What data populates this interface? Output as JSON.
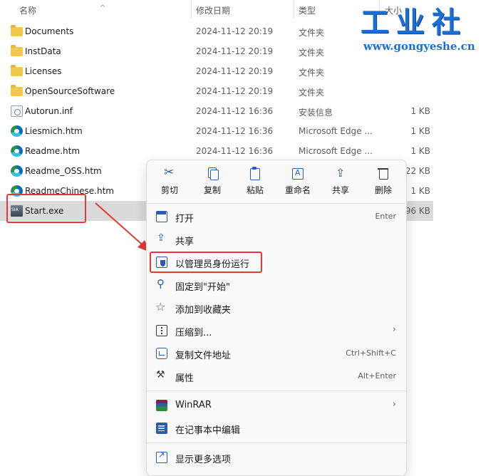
{
  "columns": {
    "name": "名称",
    "date": "修改日期",
    "type": "类型",
    "size": "大小"
  },
  "files": [
    {
      "name": "Documents",
      "date": "2024-11-12 20:19",
      "type": "文件夹",
      "size": "",
      "icon": "folder-icon"
    },
    {
      "name": "InstData",
      "date": "2024-11-12 20:19",
      "type": "文件夹",
      "size": "",
      "icon": "folder-icon"
    },
    {
      "name": "Licenses",
      "date": "2024-11-12 20:19",
      "type": "文件夹",
      "size": "",
      "icon": "folder-icon"
    },
    {
      "name": "OpenSourceSoftware",
      "date": "2024-11-12 20:19",
      "type": "文件夹",
      "size": "",
      "icon": "folder-icon"
    },
    {
      "name": "Autorun.inf",
      "date": "2024-11-12 16:36",
      "type": "安装信息",
      "size": "1 KB",
      "icon": "setup-info-icon"
    },
    {
      "name": "Liesmich.htm",
      "date": "2024-11-12 16:36",
      "type": "Microsoft Edge ...",
      "size": "1 KB",
      "icon": "edge-icon"
    },
    {
      "name": "Readme.htm",
      "date": "2024-11-12 16:36",
      "type": "Microsoft Edge ...",
      "size": "1 KB",
      "icon": "edge-icon"
    },
    {
      "name": "Readme_OSS.htm",
      "date": "",
      "type": "",
      "size": "22 KB",
      "icon": "edge-icon"
    },
    {
      "name": "ReadmeChinese.htm",
      "date": "",
      "type": "",
      "size": "1 KB",
      "icon": "edge-icon"
    },
    {
      "name": "Start.exe",
      "date": "",
      "type": "",
      "size": "96 KB",
      "icon": "exe-icon"
    }
  ],
  "watermark": {
    "title": "工业社",
    "url": "www.gongyeshe.cn"
  },
  "context_menu": {
    "quick_actions": [
      {
        "label": "剪切",
        "icon": "cut-icon"
      },
      {
        "label": "复制",
        "icon": "copy-icon"
      },
      {
        "label": "粘贴",
        "icon": "paste-icon"
      },
      {
        "label": "重命名",
        "icon": "rename-icon"
      },
      {
        "label": "共享",
        "icon": "share-icon"
      },
      {
        "label": "删除",
        "icon": "delete-icon"
      }
    ],
    "items": [
      {
        "label": "打开",
        "accel": "Enter",
        "icon": "open-icon"
      },
      {
        "label": "共享",
        "accel": "",
        "icon": "share-icon"
      },
      {
        "label": "以管理员身份运行",
        "accel": "",
        "icon": "shield-icon"
      },
      {
        "label": "固定到\"开始\"",
        "accel": "",
        "icon": "pin-icon"
      },
      {
        "label": "添加到收藏夹",
        "accel": "",
        "icon": "star-icon"
      },
      {
        "label": "压缩到...",
        "accel": "",
        "icon": "zip-icon",
        "submenu": true
      },
      {
        "label": "复制文件地址",
        "accel": "Ctrl+Shift+C",
        "icon": "copy-path-icon"
      },
      {
        "label": "属性",
        "accel": "Alt+Enter",
        "icon": "wrench-icon"
      },
      {
        "label": "WinRAR",
        "accel": "",
        "icon": "winrar-icon",
        "submenu": true
      },
      {
        "label": "在记事本中编辑",
        "accel": "",
        "icon": "notepad-icon"
      },
      {
        "label": "显示更多选项",
        "accel": "",
        "icon": "more-options-icon"
      }
    ],
    "submenu_arrow": "›"
  },
  "colors": {
    "highlight_red": "#e53935",
    "selection": "#dadada",
    "accent": "#2b5cab"
  }
}
